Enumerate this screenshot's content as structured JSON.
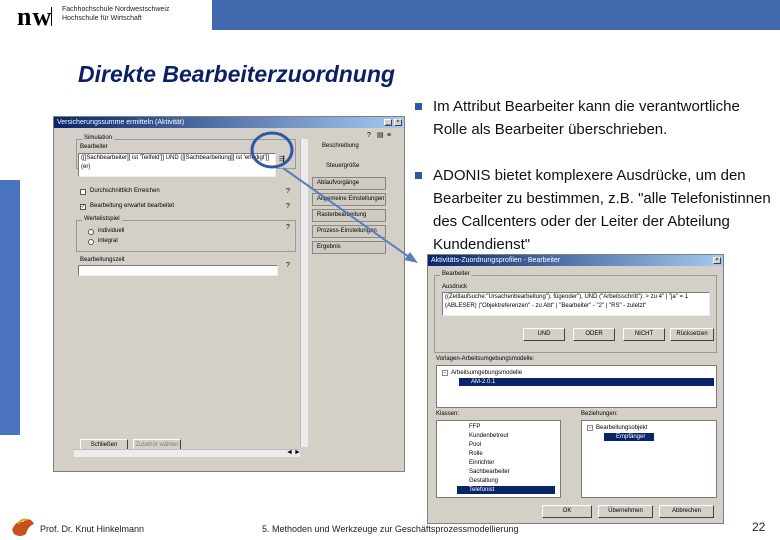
{
  "header": {
    "logo_mark": "nw",
    "school_line1": "Fachhochschule Nordwestschweiz",
    "school_line2": "Hochschule für Wirtschaft",
    "slide_title": "Direkte Bearbeiterzuordnung"
  },
  "colors": {
    "accent_blue": "#3f68ad",
    "title_navy": "#0a1f66",
    "bullet": "#2e58a6"
  },
  "bullets": [
    {
      "text": "Im Attribut Bearbeiter kann die verantwortliche Rolle als Bearbeiter überschrieben."
    },
    {
      "text": "ADONIS bietet komplexere Ausdrücke, um den Bearbeiter zu bestimmen, z.B. \"alle Telefonistinnen des Callcenters oder der Leiter der Abteilung Kundendienst\""
    }
  ],
  "win1": {
    "title": "Versicherungssumme ermitteln (Aktivität)",
    "group_label": "Simulation",
    "field_label": "Bearbeiter",
    "field_value": "([[Sachbearbeiter]] ist 'Teilfeld']] UND ([[Sachbearbeitung]] ist 'erledigt']]",
    "field_value2": "(er)",
    "check1": "Durchschnittlich Erreichen",
    "check2": "Bearbeitung erwartet bearbeitet",
    "radio_group": "Wertelistspiel",
    "radio1": "individuell",
    "radio2": "integral",
    "field3_label": "Bearbeitungszeit",
    "btn1": "Schließen",
    "btn2": "Zubehör wählen",
    "tabs": [
      "Beschreibung",
      "Steuergröße",
      "Ablaufvorgänge",
      "Allgemeine Einstellungen",
      "Rasterbearbeitung",
      "Prozess-Einstellungen",
      "Ergebnis"
    ],
    "tab_side_label": "Beschreibung",
    "tab_side_label2": "Steuergröße"
  },
  "win2": {
    "title": "Aktivitäts-Zuordnungsprofilen - Bearbeiter",
    "group_label": "Bearbeiter",
    "field_label": "Ausdruck",
    "expr_line1": "((Zeitlaufsuche:\"Ursachenbearbeitung\"), fügeoder\"), UND (\"Arbeitsschritt\"): > zu 4\" | \"ja\" = 1",
    "expr_line2": "(ABLESER) |\"Objektreferenzen\" - zu Abt\" | \"Bearbeiter\" - \"2\" | \"RS\" - zuletzt\"",
    "btn_and": "UND",
    "btn_or": "ODER",
    "btn_not": "NICHT",
    "btn_reset": "Rücksetzen",
    "tree1_label": "Vorlagen-Arbeitsumgebungsmodelle:",
    "tree1_items": [
      "Arbeitsumgebungsmodelle",
      "AM-2.0.1"
    ],
    "tree2_label": "Klassen:",
    "tree2_items": [
      "FFP",
      "Kundenbetreut",
      "Pool",
      "Rolle",
      "Einrichter",
      "Sachbearbeiter",
      "Gestaltung",
      "Telefonist"
    ],
    "tree3_label": "Beziehungen:",
    "tree3_items": [
      "Bearbeitungsobjekt",
      "Empfänger"
    ],
    "btn_ok": "OK",
    "btn_apply": "Übernehmen",
    "btn_cancel": "Abbrechen"
  },
  "footer": {
    "author": "Prof. Dr. Knut Hinkelmann",
    "course": "5. Methoden und Werkzeuge zur Geschäftsprozessmodellierung",
    "page": "22"
  }
}
